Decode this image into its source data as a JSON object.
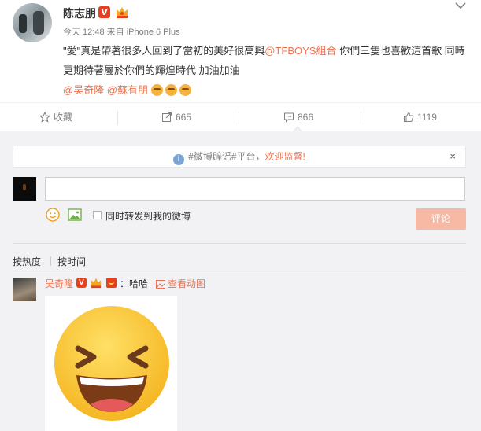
{
  "post": {
    "author": "陈志朋",
    "meta": "今天 12:48 来自 iPhone 6 Plus",
    "text_part1": "\"愛\"真是帶著很多人回到了當初的美好很高興",
    "mention_group": "@TFBOYS組合",
    "text_part2": " 你們三隻也喜歡這首歌 同時更期待著屬於你們的輝煌時代 加油加油",
    "mention1": "@吴奇隆",
    "mention2": "@蘇有朋"
  },
  "actions": {
    "favorite_label": "收藏",
    "repost_count": "665",
    "comment_count": "866",
    "like_count": "1119"
  },
  "notice": {
    "prefix": "#微博辟谣#平台，",
    "accent": "欢迎监督!",
    "close": "×"
  },
  "composer": {
    "repost_label": "同时转发到我的微博",
    "submit_label": "评论"
  },
  "sort": {
    "by_hot": "按热度",
    "by_time": "按时间"
  },
  "comment": {
    "author": "吴奇隆",
    "text": "：哈哈",
    "anim_label": "查看动图"
  },
  "colors": {
    "accent": "#eb7350",
    "badge_red": "#e8401c",
    "submit_disabled": "#f7b9a4",
    "panel_bg": "#f2f2f5"
  },
  "icons": {
    "v_badge": "V",
    "info": "i"
  }
}
